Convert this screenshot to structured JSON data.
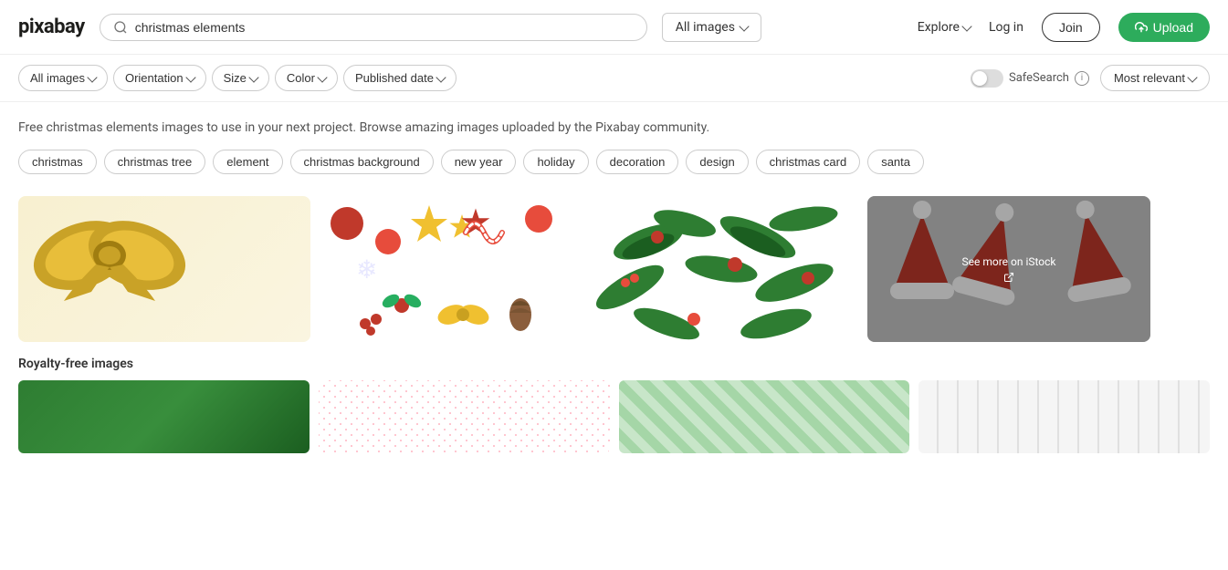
{
  "header": {
    "logo_text": "pixabay",
    "search_value": "christmas elements",
    "search_placeholder": "christmas elements",
    "image_type_label": "All images",
    "explore_label": "Explore",
    "login_label": "Log in",
    "join_label": "Join",
    "upload_label": "Upload"
  },
  "filters": {
    "all_images_label": "All images",
    "orientation_label": "Orientation",
    "size_label": "Size",
    "color_label": "Color",
    "published_date_label": "Published date",
    "safe_search_label": "SafeSearch",
    "relevance_label": "Most relevant"
  },
  "main": {
    "description": "Free christmas elements images to use in your next project. Browse amazing images uploaded by the Pixabay community.",
    "tags": [
      "christmas",
      "christmas tree",
      "element",
      "christmas background",
      "new year",
      "holiday",
      "decoration",
      "design",
      "christmas card",
      "santa"
    ],
    "royalty_label": "Royalty-free images",
    "see_more_label": "See more on iStock"
  }
}
